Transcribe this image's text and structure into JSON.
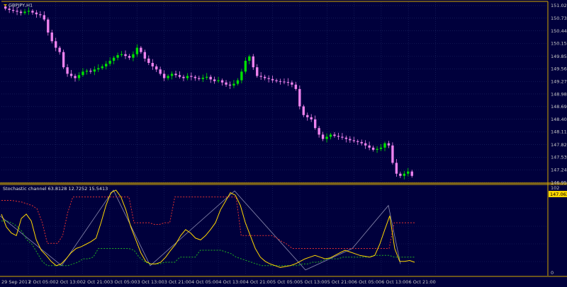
{
  "colors": {
    "background": "#00003c",
    "border": "#d4a800",
    "grid": "#1f2a66",
    "text": "#c8c8c8",
    "bull": "#00e000",
    "bear": "#ee82ee",
    "price_tag_bg": "#ffd700",
    "stoch_main": "#ffd700",
    "stoch_upper": "#e03030",
    "stoch_lower": "#20b020",
    "zigzag": "#8a8ab0"
  },
  "main_chart": {
    "title": "GBPJPY,H1",
    "title_icon": "triangle-down-icon",
    "price_labels": [
      "151.020",
      "150.730",
      "150.440",
      "150.150",
      "149.855",
      "149.565",
      "149.275",
      "148.985",
      "148.695",
      "148.405",
      "148.115",
      "147.820",
      "147.530",
      "147.240",
      "146.950"
    ],
    "current_price": "147.063"
  },
  "indicator": {
    "title": "Stochastic channel 63.8128 12.7252 15.5413",
    "scale_top": "102",
    "scale_bottom": "0"
  },
  "time_labels": [
    "29 Sep 2017",
    "2 Oct 05:00",
    "2 Oct 13:00",
    "2 Oct 21:00",
    "3 Oct 05:00",
    "3 Oct 13:00",
    "3 Oct 21:00",
    "4 Oct 05:00",
    "4 Oct 13:00",
    "4 Oct 21:00",
    "5 Oct 05:00",
    "5 Oct 13:00",
    "5 Oct 21:00",
    "6 Oct 05:00",
    "6 Oct 13:00",
    "6 Oct 21:00"
  ],
  "chart_data": {
    "type": "candlestick",
    "title": "GBPJPY,H1",
    "y_range": [
      146.95,
      151.1
    ],
    "close_path": [
      150.95,
      150.92,
      150.9,
      150.88,
      150.85,
      150.88,
      150.9,
      150.86,
      150.82,
      150.8,
      150.7,
      150.4,
      150.2,
      150.05,
      149.95,
      149.6,
      149.45,
      149.4,
      149.35,
      149.42,
      149.5,
      149.52,
      149.5,
      149.55,
      149.58,
      149.62,
      149.68,
      149.75,
      149.82,
      149.88,
      149.9,
      149.86,
      149.82,
      149.9,
      150.05,
      149.95,
      149.8,
      149.7,
      149.62,
      149.55,
      149.45,
      149.35,
      149.4,
      149.45,
      149.42,
      149.38,
      149.35,
      149.4,
      149.38,
      149.35,
      149.33,
      149.36,
      149.38,
      149.32,
      149.28,
      149.3,
      149.25,
      149.2,
      149.18,
      149.22,
      149.3,
      149.5,
      149.75,
      149.85,
      149.6,
      149.4,
      149.38,
      149.35,
      149.33,
      149.3,
      149.28,
      149.27,
      149.26,
      149.25,
      149.2,
      149.1,
      148.7,
      148.5,
      148.45,
      148.4,
      148.2,
      148.05,
      147.95,
      148.0,
      148.05,
      148.02,
      148.0,
      147.98,
      147.95,
      147.92,
      147.9,
      147.88,
      147.85,
      147.8,
      147.75,
      147.7,
      147.72,
      147.75,
      147.85,
      147.8,
      147.4,
      147.15,
      147.1,
      147.15,
      147.2,
      147.1
    ],
    "stochastic_main": [
      70,
      55,
      48,
      45,
      65,
      70,
      62,
      40,
      28,
      22,
      15,
      10,
      12,
      18,
      25,
      30,
      32,
      35,
      38,
      42,
      60,
      80,
      95,
      98,
      90,
      75,
      55,
      40,
      25,
      15,
      12,
      12,
      14,
      20,
      28,
      35,
      45,
      52,
      48,
      42,
      40,
      45,
      52,
      60,
      75,
      85,
      95,
      92,
      80,
      60,
      45,
      30,
      20,
      15,
      12,
      10,
      8,
      9,
      10,
      12,
      15,
      18,
      20,
      22,
      20,
      18,
      19,
      22,
      25,
      28,
      26,
      24,
      22,
      21,
      20,
      22,
      35,
      52,
      68,
      30,
      15,
      15,
      16,
      14
    ],
    "stochastic_upper": [
      86,
      86,
      86,
      85,
      84,
      82,
      80,
      76,
      60,
      36,
      36,
      36,
      45,
      72,
      90,
      90,
      90,
      90,
      90,
      90,
      90,
      90,
      90,
      90,
      90,
      90,
      60,
      60,
      60,
      60,
      58,
      58,
      60,
      60,
      90,
      90,
      90,
      90,
      90,
      90,
      90,
      90,
      90,
      90,
      90,
      90,
      90,
      45,
      45,
      45,
      45,
      45,
      45,
      45,
      42,
      38,
      35,
      30,
      30,
      30,
      30,
      30,
      30,
      30,
      30,
      30,
      30,
      30,
      30,
      30,
      30,
      30,
      30,
      30,
      30,
      30,
      30,
      60,
      60,
      60,
      60,
      60
    ],
    "stochastic_lower": [
      62,
      62,
      60,
      56,
      50,
      40,
      35,
      25,
      15,
      10,
      10,
      10,
      10,
      10,
      12,
      14,
      18,
      18,
      20,
      30,
      30,
      30,
      30,
      30,
      30,
      30,
      28,
      20,
      15,
      12,
      12,
      12,
      14,
      14,
      14,
      20,
      20,
      20,
      20,
      28,
      28,
      28,
      28,
      28,
      26,
      24,
      20,
      18,
      16,
      14,
      12,
      10,
      10,
      10,
      10,
      10,
      10,
      10,
      10,
      12,
      12,
      14,
      14,
      16,
      18,
      18,
      18,
      20,
      20,
      20,
      20,
      20,
      20,
      22,
      22,
      22,
      22,
      20,
      20,
      20,
      20,
      20
    ],
    "zigzag": [
      [
        0,
        68
      ],
      [
        87,
        10
      ],
      [
        160,
        98
      ],
      [
        212,
        10
      ],
      [
        331,
        97
      ],
      [
        431,
        5
      ],
      [
        497,
        30
      ],
      [
        548,
        80
      ],
      [
        565,
        12
      ]
    ]
  }
}
